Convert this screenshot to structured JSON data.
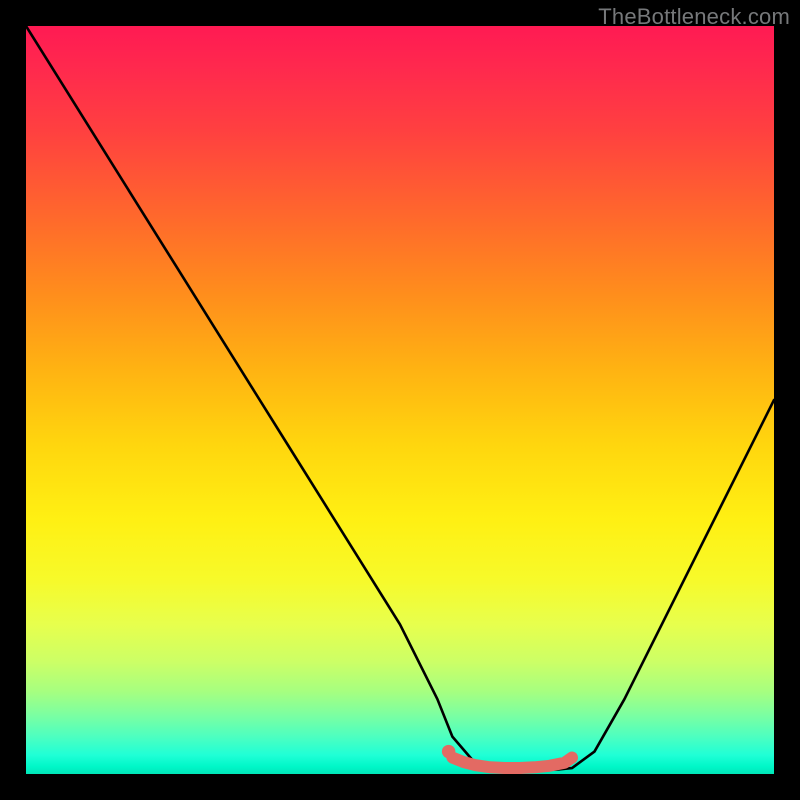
{
  "watermark": "TheBottleneck.com",
  "chart_data": {
    "type": "line",
    "title": "",
    "xlabel": "",
    "ylabel": "",
    "xlim": [
      0,
      100
    ],
    "ylim": [
      0,
      100
    ],
    "series": [
      {
        "name": "bottleneck-curve",
        "x": [
          0,
          5,
          10,
          15,
          20,
          25,
          30,
          35,
          40,
          45,
          50,
          55,
          57,
          60,
          63,
          67,
          71,
          73,
          76,
          80,
          85,
          90,
          95,
          100
        ],
        "y": [
          100,
          92,
          84,
          76,
          68,
          60,
          52,
          44,
          36,
          28,
          20,
          10,
          5,
          1.5,
          0.8,
          0.6,
          0.6,
          0.8,
          3,
          10,
          20,
          30,
          40,
          50
        ]
      }
    ],
    "marker_segment": {
      "name": "optimal-range",
      "color": "#e36a63",
      "x": [
        57,
        58.5,
        60,
        62,
        64,
        66,
        68,
        70,
        72,
        73
      ],
      "y": [
        2.2,
        1.6,
        1.2,
        0.9,
        0.8,
        0.8,
        0.9,
        1.1,
        1.5,
        2.2
      ]
    },
    "marker_dot": {
      "name": "optimal-start-dot",
      "color": "#e36a63",
      "x": 56.5,
      "y": 3.0,
      "r": 0.9
    },
    "background_gradient_stops": [
      {
        "pos": 0,
        "color": "#ff1a53"
      },
      {
        "pos": 0.5,
        "color": "#ffd60e"
      },
      {
        "pos": 0.85,
        "color": "#ccff66"
      },
      {
        "pos": 1.0,
        "color": "#00e6b8"
      }
    ]
  }
}
